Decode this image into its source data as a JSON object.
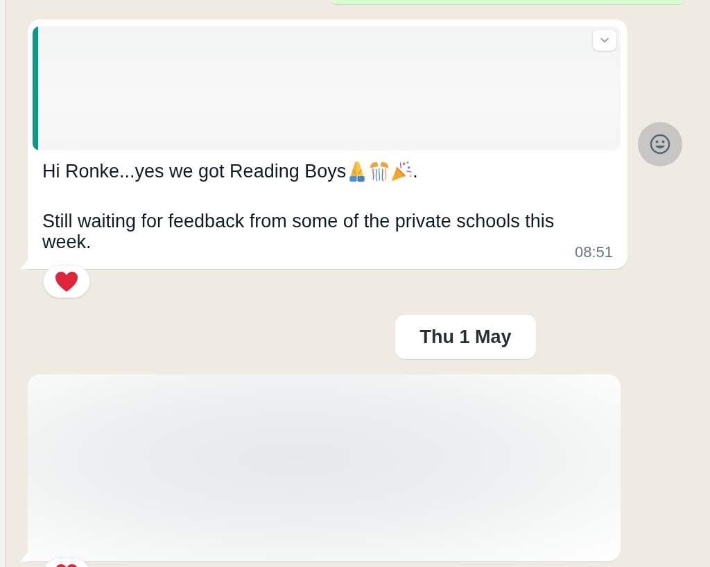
{
  "messages": [
    {
      "kind": "incoming",
      "quoted": true,
      "paragraphs": [
        {
          "text": "Hi Ronke...yes we got Reading Boys",
          "emojis": [
            {
              "kind": "folded_hands"
            },
            {
              "kind": "confetti_ball"
            },
            {
              "kind": "party_popper"
            }
          ],
          "after": "."
        },
        {
          "text": "Still waiting for feedback from some of the private schools this week."
        }
      ],
      "time": "08:51",
      "reaction": {
        "kind": "heart"
      }
    },
    {
      "kind": "date",
      "label": "Thu 1 May"
    },
    {
      "kind": "blurred",
      "reaction": {
        "kind": "heart"
      }
    }
  ]
}
